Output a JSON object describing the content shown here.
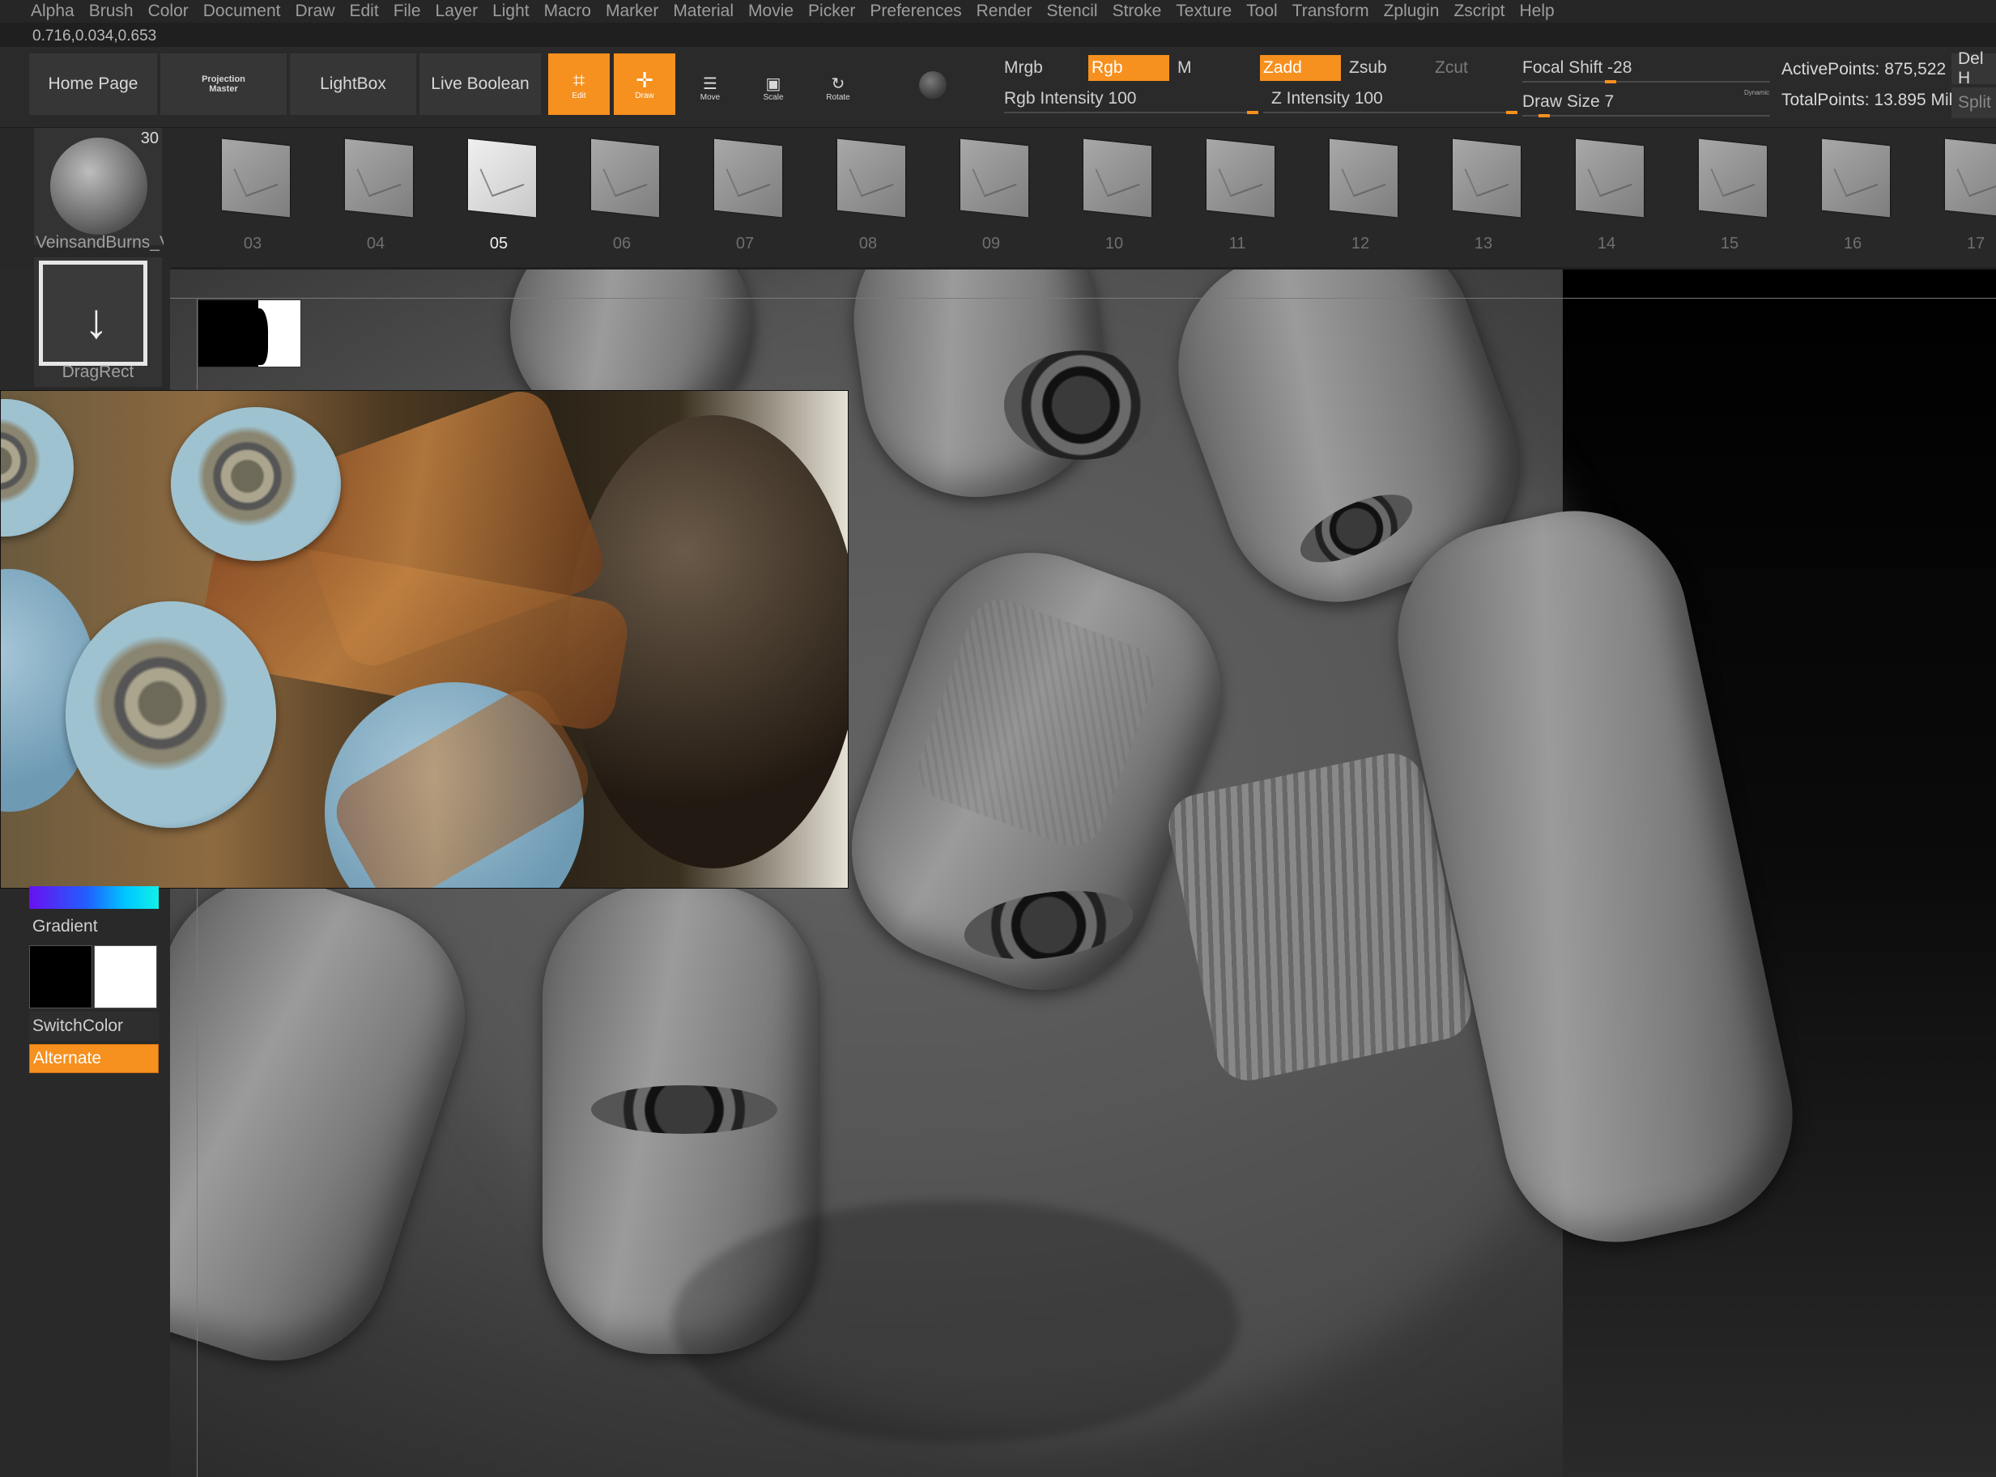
{
  "menubar": [
    "Alpha",
    "Brush",
    "Color",
    "Document",
    "Draw",
    "Edit",
    "File",
    "Layer",
    "Light",
    "Macro",
    "Marker",
    "Material",
    "Movie",
    "Picker",
    "Preferences",
    "Render",
    "Stencil",
    "Stroke",
    "Texture",
    "Tool",
    "Transform",
    "Zplugin",
    "Zscript",
    "Help"
  ],
  "coord_readout": "0.716,0.034,0.653",
  "toolbar": {
    "home_page": "Home Page",
    "projection_master_line1": "Projection",
    "projection_master_line2": "Master",
    "lightbox": "LightBox",
    "live_boolean": "Live Boolean",
    "edit": "Edit",
    "draw": "Draw",
    "move": "Move",
    "scale": "Scale",
    "rotate": "Rotate",
    "mrgb": "Mrgb",
    "rgb": "Rgb",
    "m": "M",
    "rgb_intensity": "Rgb Intensity 100",
    "zadd": "Zadd",
    "zsub": "Zsub",
    "zcut": "Zcut",
    "z_intensity": "Z Intensity 100",
    "focal_shift": "Focal Shift -28",
    "draw_size": "Draw Size 7",
    "dynamic": "Dynamic",
    "active_points": "ActivePoints: 875,522",
    "total_points": "TotalPoints: 13.895 Mil",
    "del_h": "Del H",
    "split": "Split"
  },
  "alpha": {
    "count": "30",
    "brush_name": "VeinsandBurns_V",
    "thumbs": [
      "03",
      "04",
      "05",
      "06",
      "07",
      "08",
      "09",
      "10",
      "11",
      "12",
      "13",
      "14",
      "15",
      "16",
      "17"
    ],
    "selected": "05"
  },
  "left": {
    "stroke_label": "DragRect",
    "gradient": "Gradient",
    "switch_color": "SwitchColor",
    "alternate": "Alternate"
  },
  "colors": {
    "accent": "#f6901e",
    "main_color": "#000000",
    "secondary_color": "#ffffff"
  }
}
